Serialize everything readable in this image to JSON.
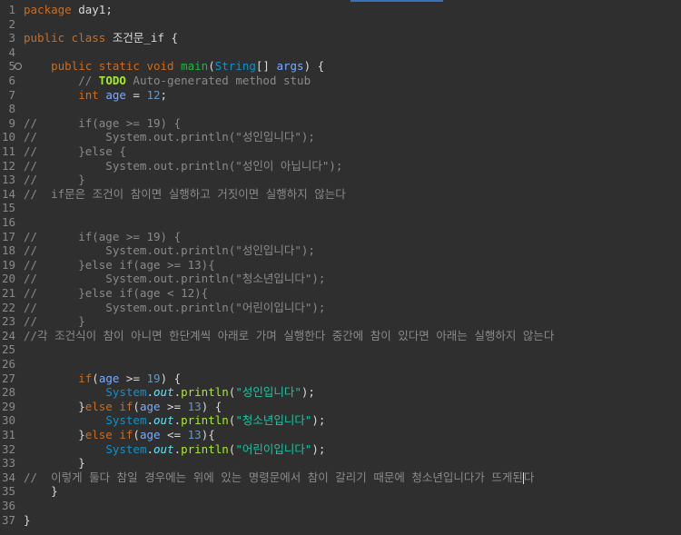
{
  "lines": [
    {
      "n": "1",
      "t": [
        [
          "kw",
          "package"
        ],
        [
          "plain",
          " day1;"
        ]
      ]
    },
    {
      "n": "2",
      "t": []
    },
    {
      "n": "3",
      "t": [
        [
          "kw",
          "public class"
        ],
        [
          "plain",
          " 조건문_if {"
        ]
      ]
    },
    {
      "n": "4",
      "t": []
    },
    {
      "n": "5",
      "t": [
        [
          "plain",
          "    "
        ],
        [
          "kw",
          "public static void"
        ],
        [
          "plain",
          " "
        ],
        [
          "fn",
          "main"
        ],
        [
          "plain",
          "("
        ],
        [
          "ty",
          "String"
        ],
        [
          "plain",
          "[] "
        ],
        [
          "var",
          "args"
        ],
        [
          "plain",
          ") {"
        ]
      ],
      "fold": true
    },
    {
      "n": "6",
      "t": [
        [
          "plain",
          "        "
        ],
        [
          "cm",
          "// "
        ],
        [
          "todo",
          "TODO"
        ],
        [
          "cm",
          " Auto-generated method stub"
        ]
      ]
    },
    {
      "n": "7",
      "t": [
        [
          "plain",
          "        "
        ],
        [
          "kw",
          "int"
        ],
        [
          "plain",
          " "
        ],
        [
          "var",
          "age"
        ],
        [
          "plain",
          " = "
        ],
        [
          "num",
          "12"
        ],
        [
          "plain",
          ";"
        ]
      ]
    },
    {
      "n": "8",
      "t": []
    },
    {
      "n": "9",
      "t": [
        [
          "cm",
          "//      if(age >= 19) {"
        ]
      ]
    },
    {
      "n": "10",
      "t": [
        [
          "cm",
          "//          System.out.println(\"성인입니다\");"
        ]
      ]
    },
    {
      "n": "11",
      "t": [
        [
          "cm",
          "//      }else {"
        ]
      ]
    },
    {
      "n": "12",
      "t": [
        [
          "cm",
          "//          System.out.println(\"성인이 아닙니다\");"
        ]
      ]
    },
    {
      "n": "13",
      "t": [
        [
          "cm",
          "//      }"
        ]
      ]
    },
    {
      "n": "14",
      "t": [
        [
          "cm",
          "//  if문은 조건이 참이면 실행하고 거짓이면 실행하지 않는다"
        ]
      ]
    },
    {
      "n": "15",
      "t": []
    },
    {
      "n": "16",
      "t": []
    },
    {
      "n": "17",
      "t": [
        [
          "cm",
          "//      if(age >= 19) {"
        ]
      ]
    },
    {
      "n": "18",
      "t": [
        [
          "cm",
          "//          System.out.println(\"성인입니다\");"
        ]
      ]
    },
    {
      "n": "19",
      "t": [
        [
          "cm",
          "//      }else if(age >= 13){"
        ]
      ]
    },
    {
      "n": "20",
      "t": [
        [
          "cm",
          "//          System.out.println(\"청소년입니다\");"
        ]
      ]
    },
    {
      "n": "21",
      "t": [
        [
          "cm",
          "//      }else if(age < 12){"
        ]
      ]
    },
    {
      "n": "22",
      "t": [
        [
          "cm",
          "//          System.out.println(\"어린이입니다\");"
        ]
      ]
    },
    {
      "n": "23",
      "t": [
        [
          "cm",
          "//      }"
        ]
      ]
    },
    {
      "n": "24",
      "t": [
        [
          "cm",
          "//각 조건식이 참이 아니면 한단계씩 아래로 가며 실행한다 중간에 참이 있다면 아래는 실행하지 않는다"
        ]
      ]
    },
    {
      "n": "25",
      "t": []
    },
    {
      "n": "26",
      "t": []
    },
    {
      "n": "27",
      "t": [
        [
          "plain",
          "        "
        ],
        [
          "kw",
          "if"
        ],
        [
          "plain",
          "("
        ],
        [
          "var",
          "age"
        ],
        [
          "plain",
          " >= "
        ],
        [
          "num",
          "19"
        ],
        [
          "plain",
          ") {"
        ]
      ]
    },
    {
      "n": "28",
      "t": [
        [
          "plain",
          "            "
        ],
        [
          "ty",
          "System"
        ],
        [
          "plain",
          "."
        ],
        [
          "fld",
          "out"
        ],
        [
          "plain",
          "."
        ],
        [
          "meth",
          "println"
        ],
        [
          "plain",
          "("
        ],
        [
          "str",
          "\"성인입니다\""
        ],
        [
          "plain",
          ");"
        ]
      ]
    },
    {
      "n": "29",
      "t": [
        [
          "plain",
          "        }"
        ],
        [
          "kw",
          "else if"
        ],
        [
          "plain",
          "("
        ],
        [
          "var",
          "age"
        ],
        [
          "plain",
          " >= "
        ],
        [
          "num",
          "13"
        ],
        [
          "plain",
          ") {"
        ]
      ]
    },
    {
      "n": "30",
      "t": [
        [
          "plain",
          "            "
        ],
        [
          "ty",
          "System"
        ],
        [
          "plain",
          "."
        ],
        [
          "fld",
          "out"
        ],
        [
          "plain",
          "."
        ],
        [
          "meth",
          "println"
        ],
        [
          "plain",
          "("
        ],
        [
          "str",
          "\"청소년입니다\""
        ],
        [
          "plain",
          ");"
        ]
      ]
    },
    {
      "n": "31",
      "t": [
        [
          "plain",
          "        }"
        ],
        [
          "kw",
          "else if"
        ],
        [
          "plain",
          "("
        ],
        [
          "var",
          "age"
        ],
        [
          "plain",
          " <= "
        ],
        [
          "num",
          "13"
        ],
        [
          "plain",
          "){"
        ]
      ]
    },
    {
      "n": "32",
      "t": [
        [
          "plain",
          "            "
        ],
        [
          "ty",
          "System"
        ],
        [
          "plain",
          "."
        ],
        [
          "fld",
          "out"
        ],
        [
          "plain",
          "."
        ],
        [
          "meth",
          "println"
        ],
        [
          "plain",
          "("
        ],
        [
          "str",
          "\"어린이입니다\""
        ],
        [
          "plain",
          ");"
        ]
      ]
    },
    {
      "n": "33",
      "t": [
        [
          "plain",
          "        }"
        ]
      ]
    },
    {
      "n": "34",
      "t": [
        [
          "cm",
          "//  이렇게 둘다 참일 경우에는 위에 있는 명령문에서 참이 갈리기 때문에 청소년입니다가 뜨게된"
        ],
        [
          "cursor",
          ""
        ],
        [
          "cm",
          "다"
        ]
      ]
    },
    {
      "n": "35",
      "t": [
        [
          "plain",
          "    }"
        ]
      ]
    },
    {
      "n": "36",
      "t": []
    },
    {
      "n": "37",
      "t": [
        [
          "plain",
          "}"
        ]
      ]
    }
  ]
}
